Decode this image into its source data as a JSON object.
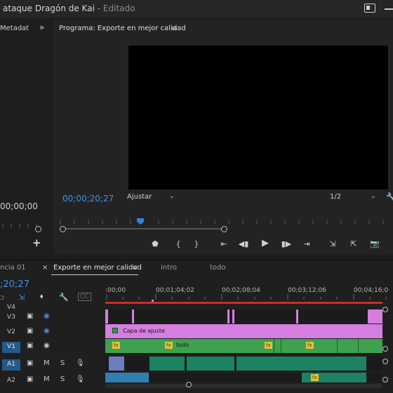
{
  "window": {
    "title": "ataque Dragón de Kai",
    "status": "- Editado"
  },
  "left_panel": {
    "tab_label": "Metadat",
    "more": "»",
    "timecode": "00;00;00",
    "add": "+"
  },
  "program": {
    "title": "Programa: Exporte en mejor calidad",
    "menu": "≡",
    "timecode": "00;00;20;27",
    "fit": "Ajustar",
    "resolution": "1/2",
    "controls": [
      "⬟",
      "{",
      "}",
      "⇤",
      "◀▮",
      "▶",
      "▮▶",
      "⇥",
      "⇲",
      "⇱",
      "📷"
    ]
  },
  "timeline": {
    "tabs": [
      {
        "label": "ncia 01"
      },
      {
        "label": "×"
      },
      {
        "label": "Exporte en mejor calidad"
      },
      {
        "label": "≡"
      },
      {
        "label": "intro"
      },
      {
        "label": "todo"
      }
    ],
    "timecode": ";20;27",
    "ruler_ticks": [
      ":00;00",
      "00;01;04;02",
      "00;02;08;04",
      "00;03;12;06",
      "00;04;16;0"
    ],
    "tracks": [
      {
        "name": "V4",
        "selected": false
      },
      {
        "name": "V3",
        "selected": false
      },
      {
        "name": "V2",
        "selected": false
      },
      {
        "name": "V1",
        "selected": true
      },
      {
        "name": "A1",
        "selected": true
      },
      {
        "name": "A2",
        "selected": false
      }
    ],
    "clips": {
      "adjustment_label": "Capa de ajuste",
      "todo_label": "todo",
      "fx": "fx"
    },
    "track_buttons": {
      "mute": "M",
      "solo": "S"
    },
    "colors": {
      "accent": "#2f82e0",
      "adjustment": "#d67ee0",
      "video_clip": "#3ea14d",
      "audio_clip": "#1d8163",
      "work_area": "#cf2a2a"
    }
  }
}
